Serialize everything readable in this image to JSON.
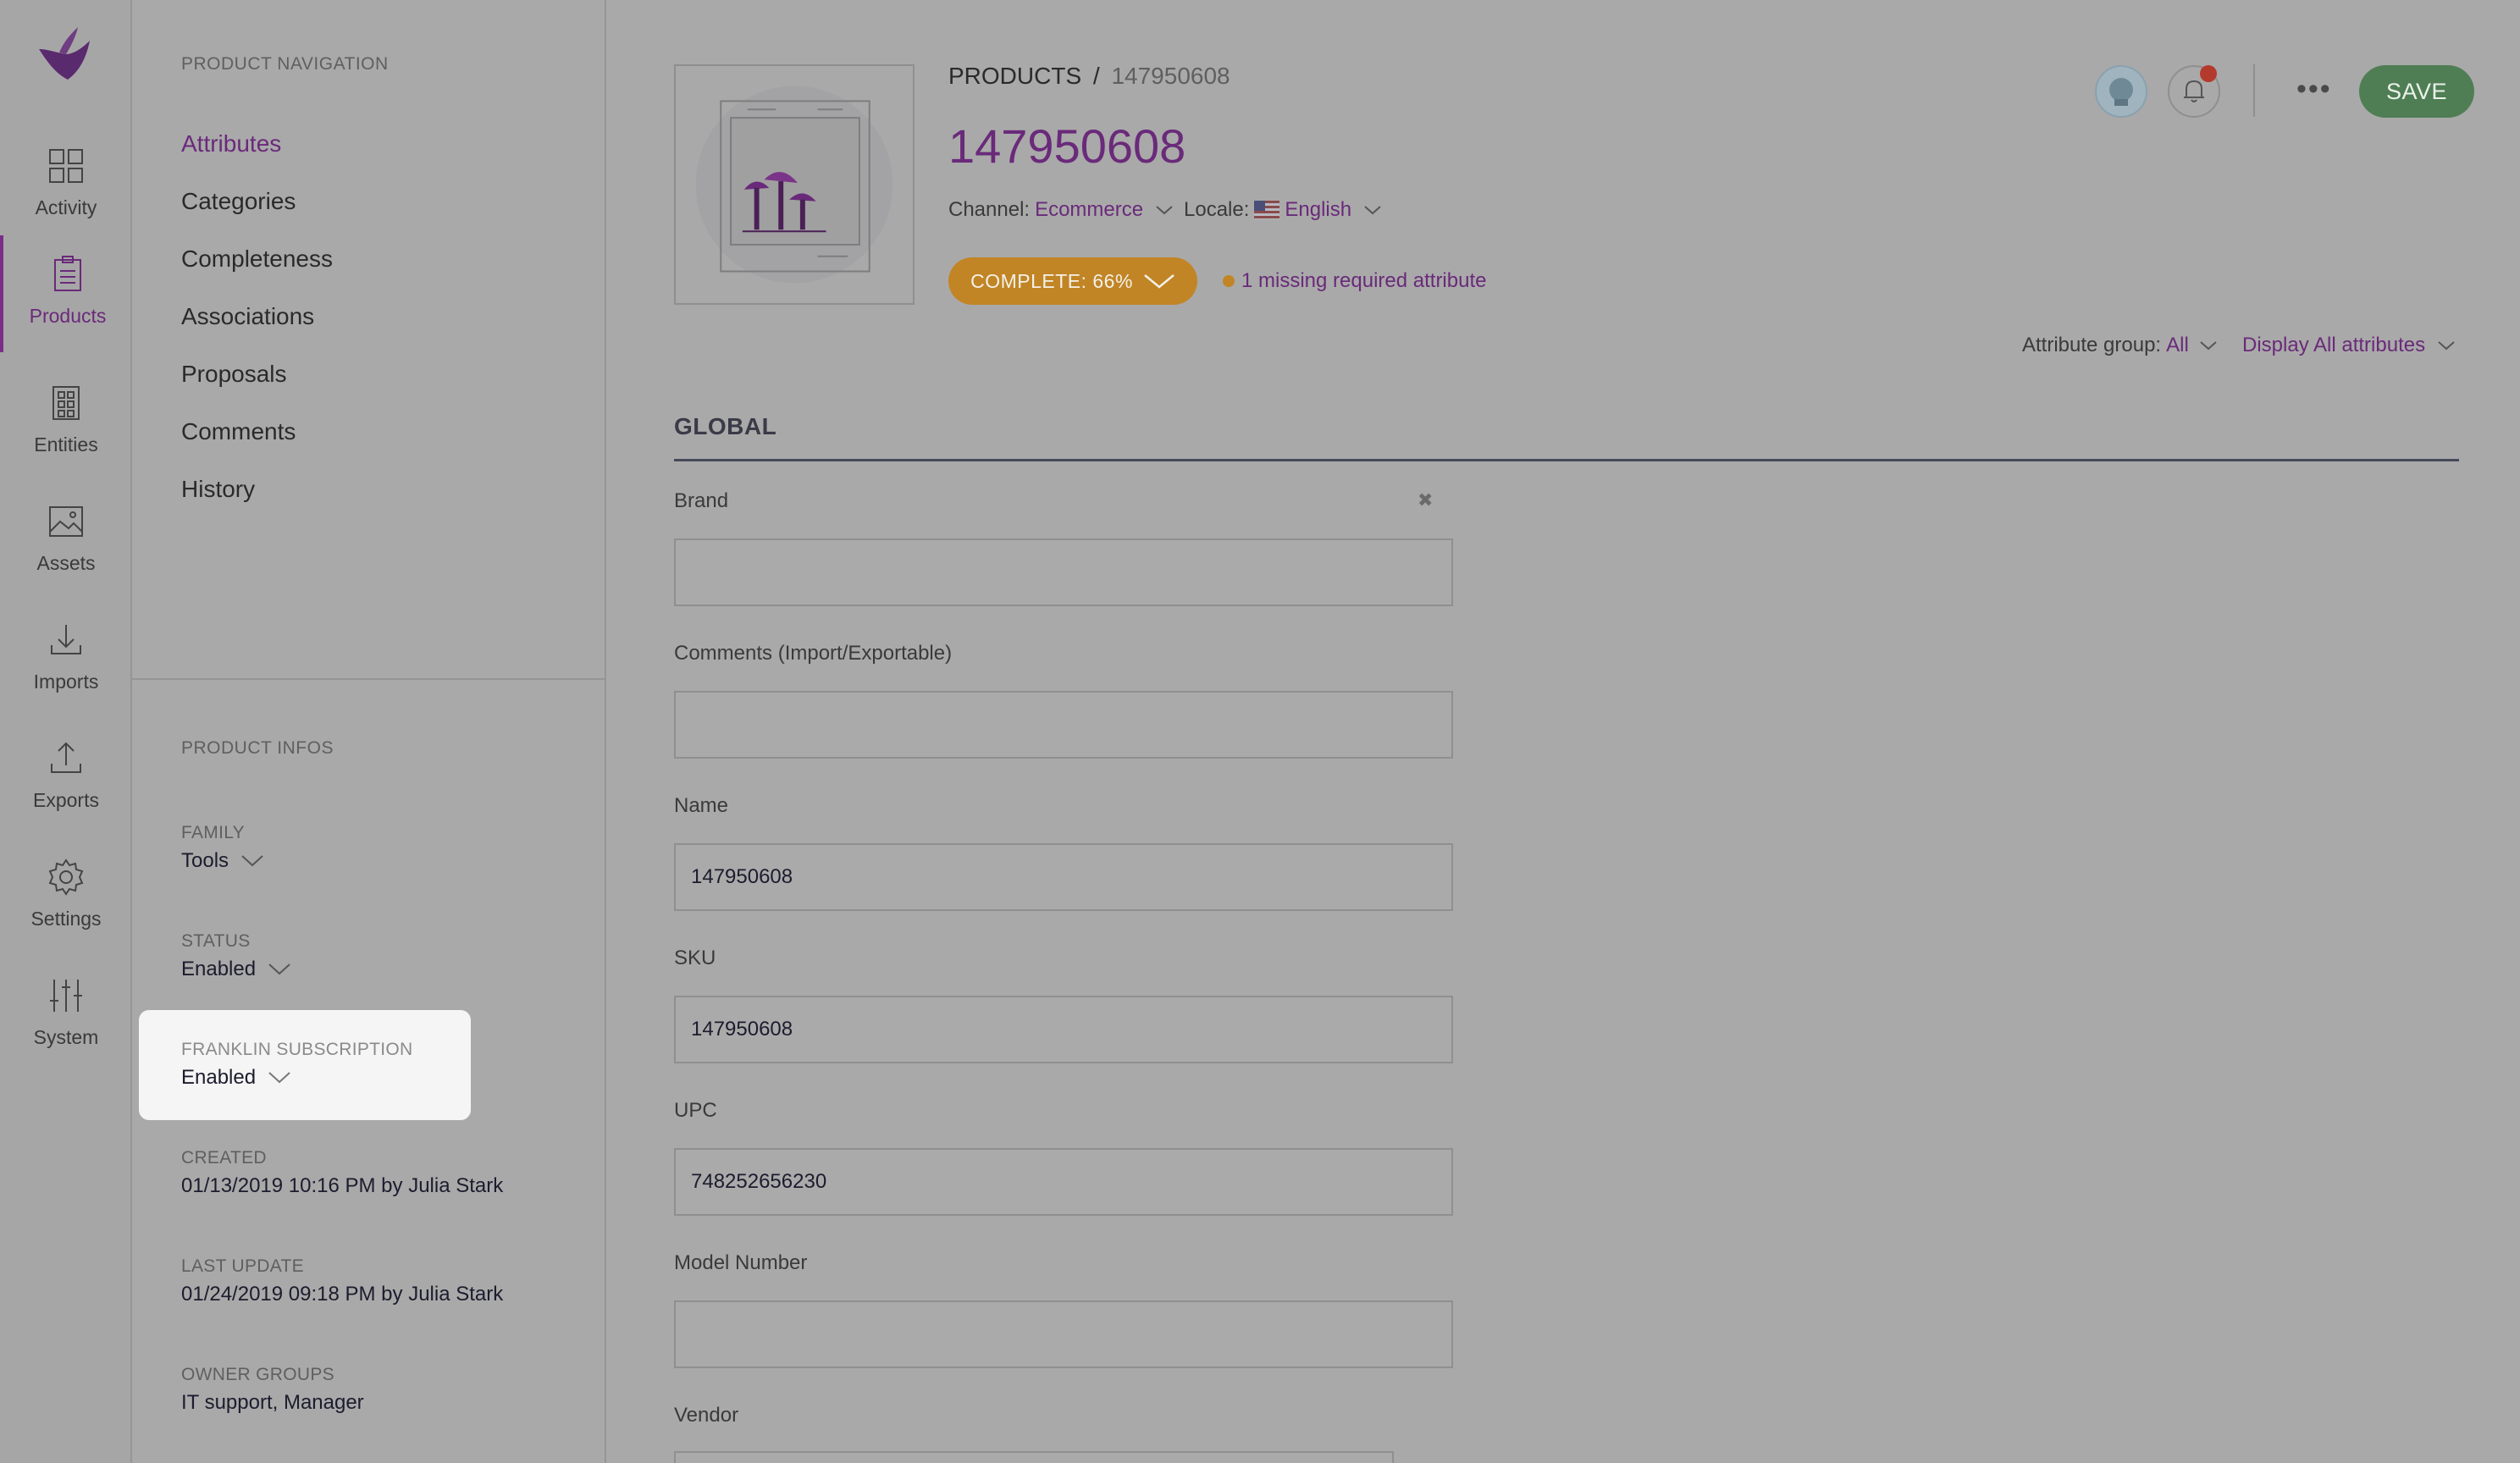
{
  "rail": {
    "items": [
      {
        "label": "Activity",
        "icon": "dashboard-icon"
      },
      {
        "label": "Products",
        "icon": "clipboard-icon"
      },
      {
        "label": "Entities",
        "icon": "entities-icon"
      },
      {
        "label": "Assets",
        "icon": "image-icon"
      },
      {
        "label": "Imports",
        "icon": "import-icon"
      },
      {
        "label": "Exports",
        "icon": "export-icon"
      },
      {
        "label": "Settings",
        "icon": "gear-icon"
      },
      {
        "label": "System",
        "icon": "sliders-icon"
      }
    ],
    "active": "Products"
  },
  "nav": {
    "title": "PRODUCT NAVIGATION",
    "items": [
      "Attributes",
      "Categories",
      "Completeness",
      "Associations",
      "Proposals",
      "Comments",
      "History"
    ],
    "active": "Attributes",
    "infos_title": "PRODUCT INFOS",
    "infos": {
      "family": {
        "label": "FAMILY",
        "value": "Tools"
      },
      "status": {
        "label": "STATUS",
        "value": "Enabled"
      },
      "franklin": {
        "label": "FRANKLIN SUBSCRIPTION",
        "value": "Enabled"
      },
      "created": {
        "label": "CREATED",
        "value": "01/13/2019 10:16 PM by Julia Stark"
      },
      "last_update": {
        "label": "LAST UPDATE",
        "value": "01/24/2019 09:18 PM by Julia Stark"
      },
      "owner_groups": {
        "label": "OWNER GROUPS",
        "value": "IT support, Manager"
      }
    }
  },
  "header": {
    "breadcrumb_root": "PRODUCTS",
    "breadcrumb_sep": "/",
    "breadcrumb_current": "147950608",
    "title": "147950608",
    "channel_label": "Channel:",
    "channel_value": "Ecommerce",
    "locale_label": "Locale:",
    "locale_value": "English",
    "complete_label": "COMPLETE: 66%",
    "missing_text": "1 missing required attribute",
    "save_label": "SAVE",
    "more_label": "•••"
  },
  "filters": {
    "group_label": "Attribute group:",
    "group_value": "All",
    "display_value": "Display All attributes"
  },
  "section": {
    "title": "GLOBAL"
  },
  "fields": [
    {
      "label": "Brand",
      "value": ""
    },
    {
      "label": "Comments (Import/Exportable)",
      "value": ""
    },
    {
      "label": "Name",
      "value": "147950608"
    },
    {
      "label": "SKU",
      "value": "147950608"
    },
    {
      "label": "UPC",
      "value": "748252656230"
    },
    {
      "label": "Model Number",
      "value": ""
    },
    {
      "label": "Vendor",
      "value": ""
    }
  ],
  "colors": {
    "accent": "#6a2a7a",
    "complete": "#c18526",
    "save": "#4f7e54",
    "notification": "#b43a2e"
  }
}
